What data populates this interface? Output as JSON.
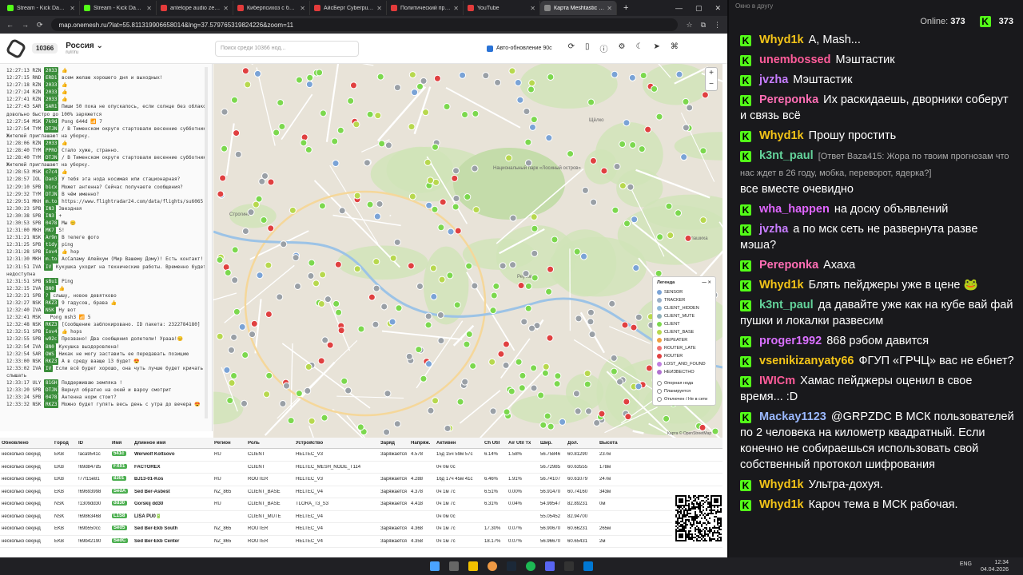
{
  "browser": {
    "tabs": [
      {
        "label": "Stream - Kick Dashbo",
        "color": "#53fc18",
        "active": false
      },
      {
        "label": "Stream - Kick Dashboa",
        "color": "#53fc18",
        "active": false
      },
      {
        "label": "antelope audio zen qui",
        "color": "#e33b3b",
        "active": false
      },
      {
        "label": "Киберпсихоз с биолог",
        "color": "#e33b3b",
        "active": false
      },
      {
        "label": "АйсБерг Cyberpunk20",
        "color": "#e33b3b",
        "active": false
      },
      {
        "label": "Политический прогнс",
        "color": "#e33b3b",
        "active": false
      },
      {
        "label": "YouTube",
        "color": "#e33b3b",
        "active": false
      },
      {
        "label": "Карта Meshtastic Росс",
        "color": "#888888",
        "active": true
      }
    ],
    "url": "map.onemesh.ru/?lat=55.811319906658014&lng=37.579765319824226&zoom=11"
  },
  "header": {
    "node_count": "10366",
    "region": "Россия",
    "region_sub": "ru/r/ru",
    "search_placeholder": "Поиск среди 10366 нод...",
    "auto_update": "Авто-обновление 90с"
  },
  "log": [
    {
      "t": "12:27:13",
      "r": "RZN",
      "id": "2033",
      "m": "👍"
    },
    {
      "t": "12:27:15",
      "r": "RND",
      "id": "ERD1",
      "m": "всем желаю хорошего дня и выходных!"
    },
    {
      "t": "12:27:18",
      "r": "RZN",
      "id": "2033",
      "m": "👍"
    },
    {
      "t": "12:27:24",
      "r": "RZN",
      "id": "2033",
      "m": "👍"
    },
    {
      "t": "12:27:41",
      "r": "RZN",
      "id": "2033",
      "m": "👍"
    },
    {
      "t": "12:27:43",
      "r": "SAR",
      "id": "SAR1",
      "m": "Пиши 50 пока не опускалось, если солнце без облаков"
    },
    {
      "t": "",
      "r": "",
      "id": "",
      "m": "довольно быстро до 100% заряжется"
    },
    {
      "t": "12:27:54",
      "r": "MSK",
      "id": "7k9d",
      "m": "Pong 644d 📶 7"
    },
    {
      "t": "12:27:54",
      "r": "TYM",
      "id": "DTJN",
      "m": "/ В Тименском округе стартовали весенние субботники."
    },
    {
      "t": "",
      "r": "",
      "id": "",
      "m": "Жителей приглашают на уборку."
    },
    {
      "t": "12:28:06",
      "r": "RZN",
      "id": "2033",
      "m": "👍"
    },
    {
      "t": "12:28:40",
      "r": "TYM",
      "id": "PPRO",
      "m": "Стало хуже, странно."
    },
    {
      "t": "12:28:40",
      "r": "TYM",
      "id": "DTJN",
      "m": "/ В Тименском округе стартовали весенние субботники."
    },
    {
      "t": "",
      "r": "",
      "id": "",
      "m": "Жителей приглашают на уборку."
    },
    {
      "t": "12:28:53",
      "r": "MSK",
      "id": "c7c4",
      "m": "👍"
    },
    {
      "t": "12:28:57",
      "r": "IOL",
      "id": "Dan3",
      "m": "У тебя эта нода носимая или стационарная?"
    },
    {
      "t": "12:29:10",
      "r": "SPB",
      "id": "bicx",
      "m": "Может антенна? Сейчас получаете сообщения?"
    },
    {
      "t": "12:29:32",
      "r": "TYM",
      "id": "DTJN",
      "m": "В чём именно?"
    },
    {
      "t": "12:29:51",
      "r": "MKH",
      "id": "m.to",
      "m": "https://www.flightradar24.com/data/flights/su6065"
    },
    {
      "t": "12:30:23",
      "r": "SPB",
      "id": "IN3",
      "m": "Звездная"
    },
    {
      "t": "12:30:38",
      "r": "SPB",
      "id": "IN3",
      "m": "+"
    },
    {
      "t": "12:30:53",
      "r": "SPB",
      "id": "0478",
      "m": "Мы 😊"
    },
    {
      "t": "12:31:00",
      "r": "MKH",
      "id": "MK7",
      "m": "S!"
    },
    {
      "t": "12:31:21",
      "r": "NSK",
      "id": "Ar9n",
      "m": "В телеге фото"
    },
    {
      "t": "12:31:25",
      "r": "SPB",
      "id": "t1dy",
      "m": "ping"
    },
    {
      "t": "12:31:28",
      "r": "SPB",
      "id": "Iov4",
      "m": "👍 hop"
    },
    {
      "t": "12:31:30",
      "r": "MKH",
      "id": "m.to",
      "m": "АсСаламу Алейкум (Мир Вашему Дому)! Есть контакт!"
    },
    {
      "t": "12:31:51",
      "r": "IVA",
      "id": "IV",
      "m": "Кукушка уходит на технические работы. Временно будет"
    },
    {
      "t": "",
      "r": "",
      "id": "",
      "m": "недоступна"
    },
    {
      "t": "12:31:51",
      "r": "SPB",
      "id": "sBu1",
      "m": "Ping"
    },
    {
      "t": "12:32:15",
      "r": "IVA",
      "id": "BN0",
      "m": "👍"
    },
    {
      "t": "12:32:21",
      "r": "SPB",
      "id": "?",
      "m": "слышу, новое девятково"
    },
    {
      "t": "12:32:27",
      "r": "NSK",
      "id": "RKZ3",
      "m": "9 гадусов, брава 👍"
    },
    {
      "t": "12:32:40",
      "r": "IVA",
      "id": "NSK",
      "m": "Ну вот"
    },
    {
      "t": "12:32:41",
      "r": "MSK",
      "id": "",
      "m": "Pong msh3 📶 5"
    },
    {
      "t": "12:32:48",
      "r": "NSK",
      "id": "RKZ3",
      "m": "[Сообщение заблокировано. ID пакета: 2322784180]"
    },
    {
      "t": "12:32:51",
      "r": "SPB",
      "id": "Iov4",
      "m": "👍 hops"
    },
    {
      "t": "12:32:55",
      "r": "SPB",
      "id": "w92c",
      "m": "Прозвано! Два сообщения долетели! Урааа!😊"
    },
    {
      "t": "12:32:54",
      "r": "IVA",
      "id": "BN0",
      "m": "Кукушка выздоровлена!"
    },
    {
      "t": "12:32:54",
      "r": "SAR",
      "id": "OWS",
      "m": "Никак не могу заставить ее передавать позицию"
    },
    {
      "t": "12:33:00",
      "r": "NSK",
      "id": "RKZ3",
      "m": "А в среду вааще 13 будет 😍"
    },
    {
      "t": "12:33:02",
      "r": "IVA",
      "id": "IV",
      "m": "Если всё будет хорошо, она чуть лучше будет кричать и"
    },
    {
      "t": "",
      "r": "",
      "id": "",
      "m": "слышать"
    },
    {
      "t": "12:33:17",
      "r": "ULY",
      "id": "81GH",
      "m": "Поддерживаю землякa !"
    },
    {
      "t": "12:33:20",
      "r": "SPB",
      "id": "DTJN",
      "m": "Вернул обратно на окей и вароу смотрит"
    },
    {
      "t": "12:33:24",
      "r": "SPB",
      "id": "0478",
      "m": "Антенна норм стоит?"
    },
    {
      "t": "12:33:32",
      "r": "NSK",
      "id": "RKZ3",
      "m": "Можно будет гулять весь день с утра до вечера 😍"
    }
  ],
  "map": {
    "legend_title": "Легенда",
    "legend": [
      {
        "label": "SENSOR",
        "color": "#7aa3d6"
      },
      {
        "label": "TRACKER",
        "color": "#9ab0c8"
      },
      {
        "label": "CLIENT_HIDDEN",
        "color": "#8fb8d8"
      },
      {
        "label": "CLIENT_MUTE",
        "color": "#8fb0b8"
      },
      {
        "label": "CLIENT",
        "color": "#7cd84e"
      },
      {
        "label": "CLIENT_BASE",
        "color": "#b7d84e"
      },
      {
        "label": "REPEATER",
        "color": "#f0a040"
      },
      {
        "label": "ROUTER_LATE",
        "color": "#f07070"
      },
      {
        "label": "ROUTER",
        "color": "#e04040"
      },
      {
        "label": "LOST_AND_FOUND",
        "color": "#c080e0"
      },
      {
        "label": "НЕИЗВЕСТНО",
        "color": "#b070d0"
      }
    ],
    "legend_status": [
      "Опорная нода",
      "Планируется",
      "Отключен / Не в сети"
    ],
    "attribution": "Карта © OpenStreetMap",
    "labels": [
      "Национальный парк «Лосиный остров»",
      "Щёлко",
      "Балашиха",
      "Реутов",
      "Строгино"
    ]
  },
  "table": {
    "headers": [
      "Обновлено",
      "Город",
      "ID",
      "Имя",
      "Длинное имя",
      "Регион",
      "Роль",
      "Устройство",
      "Заряд",
      "Напряж.",
      "Активен",
      "Ch Util",
      "Air Util Tx",
      "Шир.",
      "Дол.",
      "Высота"
    ],
    "rows": [
      [
        "несколько секунд",
        "EKB",
        "!aca9541c",
        "541c",
        "Werwolf Koltsovo",
        "RU",
        "CLIENT",
        "HELTEC_V3",
        "Заряжается",
        "4.578",
        "15д 15ч 59м 57с",
        "6.14%",
        "1.58%",
        "56.75846",
        "60.81290",
        "237м"
      ],
      [
        "несколько секунд",
        "EKB",
        "!69d847d5",
        "FX01",
        "FACTOREX",
        "",
        "CLIENT",
        "HELTEC_MESH_NODE_T114",
        "",
        "",
        "0ч 0м 0с",
        "",
        "",
        "56.72985",
        "60.63555",
        "178м"
      ],
      [
        "несколько секунд",
        "EKB",
        "!77f15e81",
        "8301",
        "BJ13-01-Kos",
        "RU",
        "ROUTER",
        "HELTEC_V3",
        "Заряжается",
        "4.288",
        "16д 17ч 45м 41с",
        "6.46%",
        "1.91%",
        "56.74107",
        "60.61079",
        "247м"
      ],
      [
        "несколько секунд",
        "EKB",
        "!69693998",
        "SedA",
        "Sed Ber-Asbest",
        "NZ_865",
        "CLIENT_BASE",
        "HELTEC_V4",
        "Заряжается",
        "4.378",
        "0ч 1м 7с",
        "6.51%",
        "0.00%",
        "56.91470",
        "60.74160",
        "343м"
      ],
      [
        "несколько секунд",
        "NSK",
        "!1309dd30",
        "dd30",
        "Gorskij dd30",
        "RU",
        "CLIENT_BASE",
        "TLORA_T3_S3",
        "Заряжается",
        "4.418",
        "0ч 1м 7с",
        "6.31%",
        "0.04%",
        "54.99547",
        "82.89231",
        "0м"
      ],
      [
        "несколько секунд",
        "NSK",
        "!69863468",
        "L1S8",
        "LISA PU0🔋",
        "",
        "CLIENT_MUTE",
        "HELTEC_V4",
        "",
        "",
        "0ч 0м 0с",
        "",
        "",
        "55.05452",
        "82.94700",
        ""
      ],
      [
        "несколько секунд",
        "EKB",
        "!69b550cc",
        "Sed5",
        "Sed Ber-Ekb South",
        "NZ_865",
        "ROUTER",
        "HELTEC_V4",
        "Заряжается",
        "4.368",
        "0ч 1м 7с",
        "17.30%",
        "0.07%",
        "56.90670",
        "60.66231",
        "265м"
      ],
      [
        "несколько секунд",
        "EKB",
        "!69b42190",
        "SedC",
        "Sed Ber-Ekb Center",
        "NZ_865",
        "ROUTER",
        "HELTEC_V4",
        "Заряжается",
        "4.358",
        "0ч 1м 7с",
        "18.17%",
        "0.07%",
        "56.96670",
        "60.65431",
        "2м"
      ]
    ]
  },
  "chat": {
    "window_title": "Окно в другу",
    "online_label": "Online:",
    "online_count": "373",
    "viewer_count": "373",
    "messages": [
      {
        "user": "Whyd1k",
        "color": "#f5c518",
        "text": "A, Mash...",
        "reply": ""
      },
      {
        "user": "unembossed",
        "color": "#ff5c9a",
        "text": "Мэштастик",
        "reply": ""
      },
      {
        "user": "jvzha",
        "color": "#c77dff",
        "text": "Мэштастик",
        "reply": ""
      },
      {
        "user": "Pereponka",
        "color": "#ff6eb4",
        "text": "Их раскидаешь, дворники соберут и связь всё",
        "reply": ""
      },
      {
        "user": "Whyd1k",
        "color": "#f5c518",
        "text": "Прошу простить",
        "reply": ""
      },
      {
        "user": "k3nt_paul",
        "color": "#63d29a",
        "text": "все вместе очевидно",
        "reply": "[Ответ Baza415: Жора по твоим прогнозам что нас ждет в 26 году, мобка, переворот, ядерка?]"
      },
      {
        "user": "wha_happen",
        "color": "#e066ff",
        "text": "на доску объявлений",
        "reply": ""
      },
      {
        "user": "jvzha",
        "color": "#c77dff",
        "text": "а по мск сеть не развернута разве мэша?",
        "reply": ""
      },
      {
        "user": "Pereponka",
        "color": "#ff6eb4",
        "text": "Ахаха",
        "reply": ""
      },
      {
        "user": "Whyd1k",
        "color": "#f5c518",
        "text": "Блять пейджеры уже в цене 🐸",
        "reply": ""
      },
      {
        "user": "k3nt_paul",
        "color": "#63d29a",
        "text": "да давайте уже как на кубе вай фай пушки и локалки развесим",
        "reply": ""
      },
      {
        "user": "proger1992",
        "color": "#d970ff",
        "text": "868 рэбом давится",
        "reply": ""
      },
      {
        "user": "vsenikizanyaty66",
        "color": "#f5c518",
        "text": "ФГУП «ГРЧЦ» вас не ебнет?",
        "reply": ""
      },
      {
        "user": "IWICm",
        "color": "#ff5c9a",
        "text": "Хамас пейджеры оценил в свое время... :D",
        "reply": ""
      },
      {
        "user": "Mackay1123",
        "color": "#9ab8ff",
        "text": "@GRPZDC В МСК пользователей по 2 человека на километр квадратный. Если конечно не собираешься использовать свой собственный протокол шифрования",
        "reply": ""
      },
      {
        "user": "Whyd1k",
        "color": "#f5c518",
        "text": "Ультра-дохуя.",
        "reply": ""
      },
      {
        "user": "Whyd1k",
        "color": "#f5c518",
        "text": "Кароч тема в МСК рабочая.",
        "reply": ""
      }
    ]
  },
  "taskbar": {
    "lang": "ENG",
    "time": "12:34",
    "date": "04.04.2026"
  }
}
